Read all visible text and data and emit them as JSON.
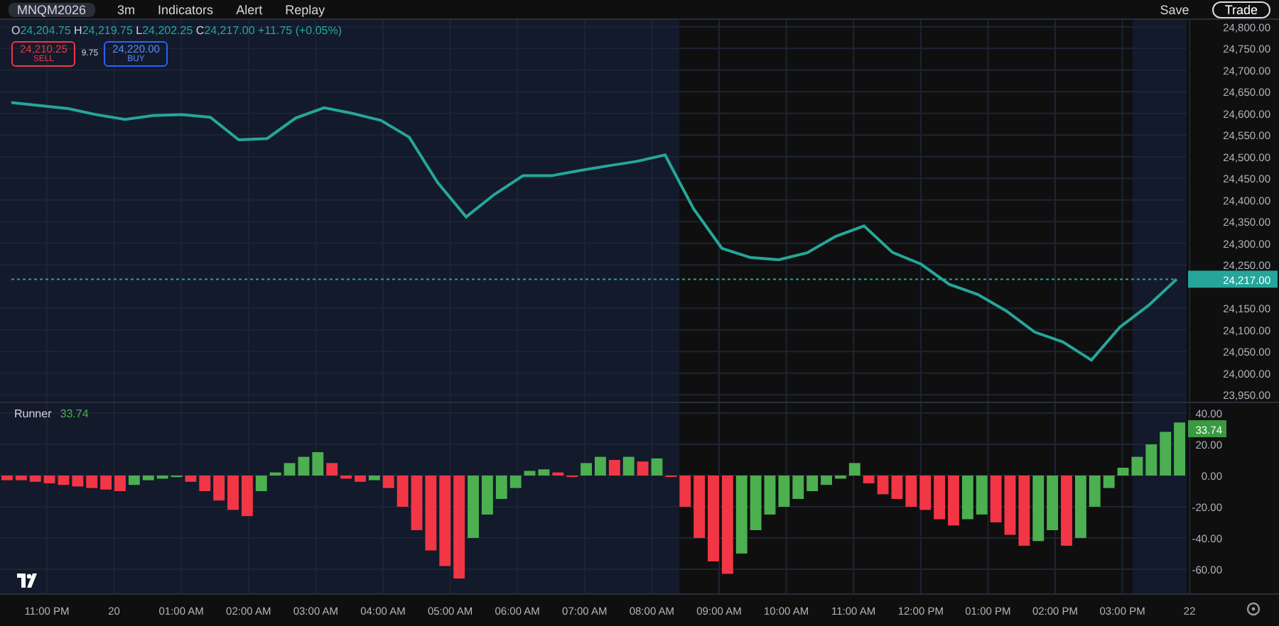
{
  "toolbar": {
    "symbol": "MNQM2026",
    "interval": "3m",
    "items": [
      "Indicators",
      "Alert",
      "Replay"
    ],
    "layout_status": "Save",
    "trade_button": "Trade"
  },
  "legend": {
    "open_label": "O",
    "open": "24,204.75",
    "high_label": "H",
    "high": "24,219.75",
    "low_label": "L",
    "low": "24,202.25",
    "close_label": "C",
    "close": "24,217.00",
    "change": "+11.75 (+0.05%)"
  },
  "order_buttons": {
    "sell_price": "24,210.25",
    "sell_label": "SELL",
    "spread": "9.75",
    "buy_price": "24,220.00",
    "buy_label": "BUY"
  },
  "price_chart": {
    "last_price": "24,217.00",
    "chart_data": {
      "type": "line",
      "grid": true,
      "ylim": [
        23934,
        24816
      ],
      "yticks": [
        {
          "value": 24800,
          "label": "24,800.00"
        },
        {
          "value": 24750,
          "label": "24,750.00"
        },
        {
          "value": 24700,
          "label": "24,700.00"
        },
        {
          "value": 24650,
          "label": "24,650.00"
        },
        {
          "value": 24600,
          "label": "24,600.00"
        },
        {
          "value": 24550,
          "label": "24,550.00"
        },
        {
          "value": 24500,
          "label": "24,500.00"
        },
        {
          "value": 24450,
          "label": "24,450.00"
        },
        {
          "value": 24400,
          "label": "24,400.00"
        },
        {
          "value": 24350,
          "label": "24,350.00"
        },
        {
          "value": 24300,
          "label": "24,300.00"
        },
        {
          "value": 24250,
          "label": "24,250.00"
        },
        {
          "value": 24150,
          "label": "24,150.00"
        },
        {
          "value": 24100,
          "label": "24,100.00"
        },
        {
          "value": 24050,
          "label": "24,050.00"
        },
        {
          "value": 24000,
          "label": "24,000.00"
        },
        {
          "value": 23950,
          "label": "23,950.00"
        }
      ],
      "series": [
        {
          "color": "#26a69a",
          "values": [
            24625,
            24618,
            24611,
            24597,
            24586,
            24595,
            24597,
            24591,
            24539,
            24542,
            24589,
            24613,
            24600,
            24584,
            24545,
            24440,
            24361,
            24413,
            24456,
            24456,
            24468,
            24479,
            24489,
            24504,
            24380,
            24288,
            24267,
            24262,
            24278,
            24316,
            24340,
            24279,
            24252,
            24205,
            24182,
            24144,
            24095,
            24072,
            24030,
            24106,
            24156,
            24217
          ]
        },
        {
          "color": "#26a69a",
          "line_style": "dashed",
          "values": [
            24217,
            24217,
            24217,
            24217,
            24217,
            24217,
            24217,
            24217,
            24217,
            24217,
            24217,
            24217,
            24217,
            24217,
            24217,
            24217,
            24217,
            24217,
            24217,
            24217,
            24217,
            24217,
            24217,
            24217,
            24217,
            24217,
            24217,
            24217,
            24217,
            24217,
            24217,
            24217,
            24217,
            24217,
            24217,
            24217,
            24217,
            24217,
            24217,
            24217,
            24217,
            24217
          ]
        }
      ]
    }
  },
  "indicator": {
    "name": "Runner",
    "value": "33.74",
    "last_value": "33.74",
    "chart_data": {
      "type": "bar",
      "grid": true,
      "ylim": [
        -75.5,
        46.4
      ],
      "yticks": [
        {
          "value": 40,
          "label": "40.00"
        },
        {
          "value": 20,
          "label": "20.00"
        },
        {
          "value": 0,
          "label": "0.00"
        },
        {
          "value": -20,
          "label": "-20.00"
        },
        {
          "value": -40,
          "label": "-40.00"
        },
        {
          "value": -60,
          "label": "-60.00"
        }
      ],
      "series": [
        {
          "color": "#4caf50",
          "values": [
            null,
            null,
            null,
            null,
            null,
            null,
            null,
            null,
            null,
            -6,
            -3,
            -2,
            -1,
            null,
            null,
            null,
            null,
            null,
            -10,
            2,
            8,
            12,
            15,
            null,
            null,
            null,
            -3,
            null,
            null,
            null,
            null,
            null,
            null,
            -40,
            -25,
            -15,
            -8,
            3,
            4,
            null,
            null,
            8,
            12,
            null,
            12,
            null,
            11,
            null,
            null,
            null,
            null,
            null,
            -50,
            -35,
            -25,
            -20,
            -15,
            -10,
            -6,
            -2,
            8,
            null,
            null,
            null,
            null,
            null,
            null,
            null,
            -28,
            -25,
            null,
            null,
            null,
            -42,
            -35,
            null,
            -40,
            -20,
            -8,
            5,
            12,
            20,
            28,
            34
          ]
        },
        {
          "color": "#f23645",
          "values": [
            -3,
            -3,
            -4,
            -5,
            -6,
            -7,
            -8,
            -9,
            -10,
            null,
            null,
            null,
            null,
            -4,
            -10,
            -16,
            -22,
            -26,
            null,
            null,
            null,
            null,
            null,
            8,
            -2,
            -4,
            null,
            -8,
            -20,
            -35,
            -48,
            -58,
            -66,
            null,
            null,
            null,
            null,
            null,
            null,
            2,
            0,
            null,
            null,
            10,
            null,
            9,
            null,
            0,
            -20,
            -40,
            -55,
            -63,
            null,
            null,
            null,
            null,
            null,
            null,
            null,
            null,
            null,
            -5,
            -12,
            -15,
            -20,
            -22,
            -28,
            -32,
            null,
            null,
            -30,
            -38,
            -45,
            null,
            null,
            -45,
            null,
            null,
            null,
            null,
            null,
            null,
            null,
            null
          ]
        }
      ]
    }
  },
  "time_axis": [
    "11:00 PM",
    "20",
    "01:00 AM",
    "02:00 AM",
    "03:00 AM",
    "04:00 AM",
    "05:00 AM",
    "06:00 AM",
    "07:00 AM",
    "08:00 AM",
    "09:00 AM",
    "10:00 AM",
    "11:00 AM",
    "12:00 PM",
    "01:00 PM",
    "02:00 PM",
    "03:00 PM",
    "22"
  ]
}
